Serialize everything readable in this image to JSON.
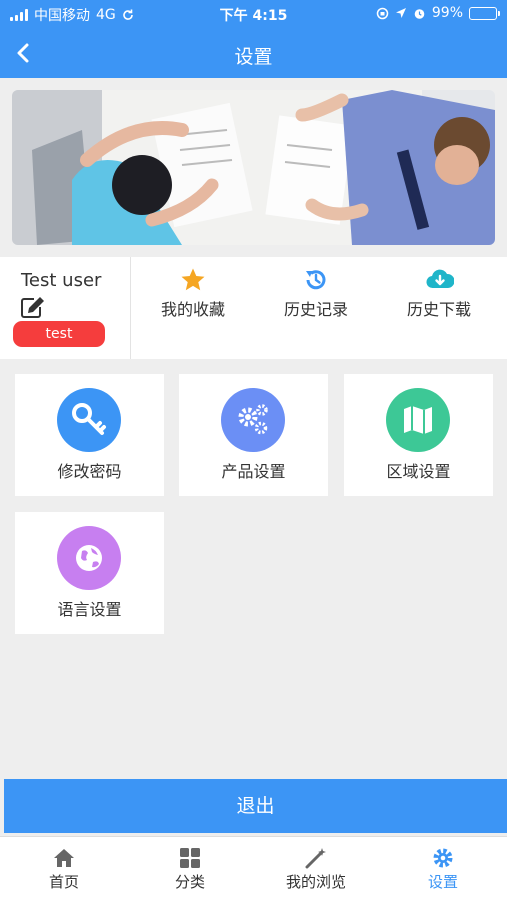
{
  "status_bar": {
    "carrier": "中国移动",
    "network": "4G",
    "time": "下午 4:15",
    "battery": "99%",
    "battery_level": 0.99
  },
  "nav": {
    "title": "设置",
    "back_icon": "chevron-left-icon"
  },
  "banner": {
    "image": "office-meeting-photo"
  },
  "user": {
    "name": "Test user",
    "edit_icon": "edit-icon",
    "tag": "test"
  },
  "quick_actions": [
    {
      "label": "我的收藏",
      "icon": "star-icon",
      "color": "#f5a623"
    },
    {
      "label": "历史记录",
      "icon": "history-icon",
      "color": "#3c95f5"
    },
    {
      "label": "历史下载",
      "icon": "cloud-download-icon",
      "color": "#1fb5c9"
    }
  ],
  "settings": [
    {
      "label": "修改密码",
      "icon": "key-icon",
      "color": "#3c95f5"
    },
    {
      "label": "产品设置",
      "icon": "gears-icon",
      "color": "#6b8ff5"
    },
    {
      "label": "区域设置",
      "icon": "map-icon",
      "color": "#3dc896"
    },
    {
      "label": "语言设置",
      "icon": "globe-icon",
      "color": "#c77ff0"
    }
  ],
  "logout_label": "退出",
  "tabs": [
    {
      "label": "首页",
      "icon": "home-icon",
      "active": false
    },
    {
      "label": "分类",
      "icon": "grid-icon",
      "active": false
    },
    {
      "label": "我的浏览",
      "icon": "magic-wand-icon",
      "active": false
    },
    {
      "label": "设置",
      "icon": "gear-icon",
      "active": true
    }
  ],
  "colors": {
    "primary": "#3c95f5",
    "tag_red": "#f53d3d",
    "background": "#eeeeee"
  }
}
